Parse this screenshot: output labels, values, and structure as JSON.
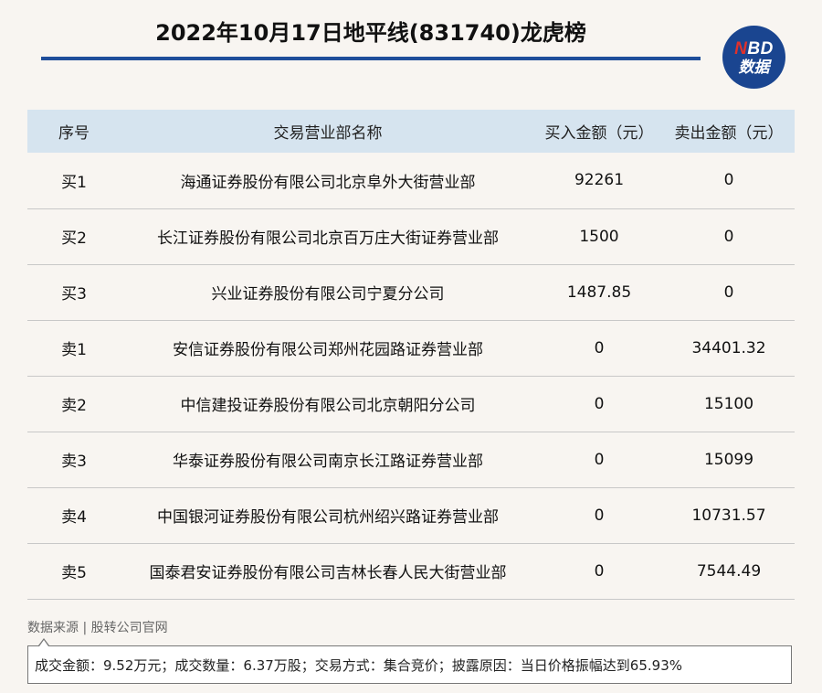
{
  "header": {
    "title": "2022年10月17日地平线(831740)龙虎榜",
    "logo_line1_accent": "N",
    "logo_line1_rest": "BD",
    "logo_line2": "数据"
  },
  "table": {
    "columns": [
      "序号",
      "交易营业部名称",
      "买入金额（元）",
      "卖出金额（元）"
    ],
    "rows": [
      [
        "买1",
        "海通证券股份有限公司北京阜外大街营业部",
        "92261",
        "0"
      ],
      [
        "买2",
        "长江证券股份有限公司北京百万庄大街证券营业部",
        "1500",
        "0"
      ],
      [
        "买3",
        "兴业证券股份有限公司宁夏分公司",
        "1487.85",
        "0"
      ],
      [
        "卖1",
        "安信证券股份有限公司郑州花园路证券营业部",
        "0",
        "34401.32"
      ],
      [
        "卖2",
        "中信建投证券股份有限公司北京朝阳分公司",
        "0",
        "15100"
      ],
      [
        "卖3",
        "华泰证券股份有限公司南京长江路证券营业部",
        "0",
        "15099"
      ],
      [
        "卖4",
        "中国银河证券股份有限公司杭州绍兴路证券营业部",
        "0",
        "10731.57"
      ],
      [
        "卖5",
        "国泰君安证券股份有限公司吉林长春人民大街营业部",
        "0",
        "7544.49"
      ]
    ]
  },
  "footer": {
    "source": "数据来源 | 股转公司官网",
    "note": "成交金额：9.52万元；成交数量：6.37万股；交易方式：集合竞价；披露原因：当日价格振幅达到65.93%"
  },
  "colors": {
    "accent": "#1f4e9a",
    "header_bg": "#d6e4ef",
    "logo_bg": "#1a4590",
    "logo_accent": "#e0312b"
  }
}
